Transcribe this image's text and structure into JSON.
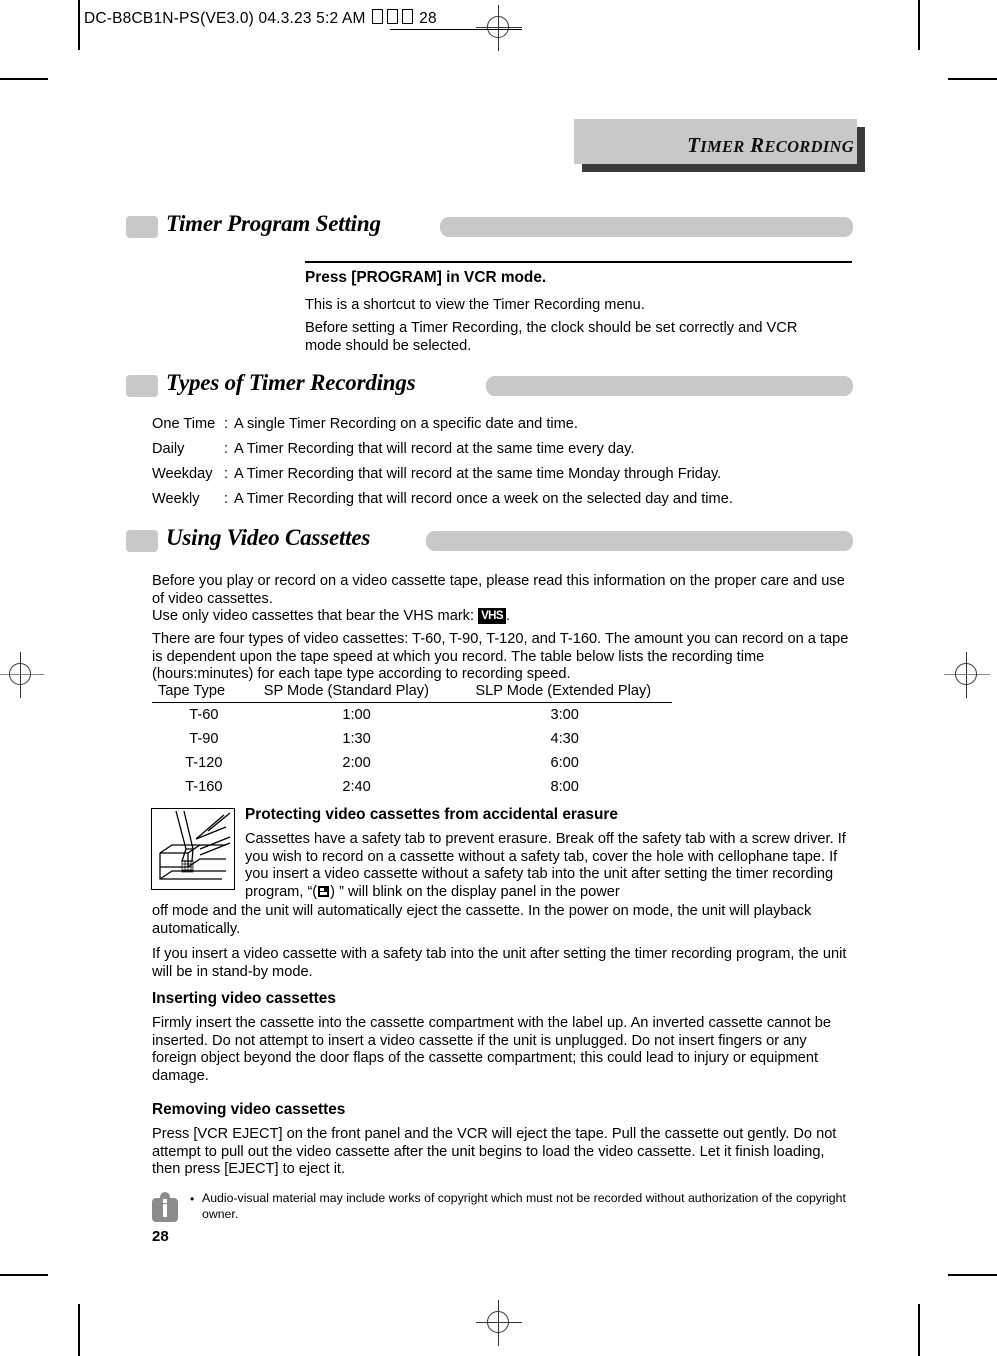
{
  "print_marks": {
    "slug": "DC-B8CB1N-PS(VE3.0)   04.3.23 5:2 AM   ",
    "slug_page": "28"
  },
  "running_head": {
    "word1_cap": "T",
    "word1_rest": "IMER",
    "word2_cap": "R",
    "word2_rest": "ECORDING"
  },
  "sections": {
    "timer_program_setting": {
      "title": "Timer Program Setting",
      "lead": "Press [PROGRAM] in VCR mode.",
      "line1": "This is a shortcut to view the Timer Recording menu.",
      "line2": "Before setting a Timer Recording, the clock should be set correctly and VCR",
      "line3": "mode should be selected."
    },
    "types_of_timer_recordings": {
      "title": "Types of Timer Recordings",
      "rows": [
        {
          "key": "One Time",
          "sep": ":",
          "desc": "A single Timer Recording on a specific date and time."
        },
        {
          "key": "Daily",
          "sep": ":",
          "desc": "A Timer Recording that will record at the same time every day."
        },
        {
          "key": "Weekday",
          "sep": ":",
          "desc": "A Timer Recording that will record at the same time Monday through Friday."
        },
        {
          "key": "Weekly",
          "sep": ":",
          "desc": "A Timer Recording that will record once a week on the selected day and time."
        }
      ]
    },
    "using_video_cassettes": {
      "title": "Using Video Cassettes",
      "para1": "Before you play or record on a video cassette tape, please read this information on the proper care and use of video cassettes.",
      "vhs_line_prefix": "Use only video cassettes that bear the VHS mark: ",
      "vhs_mark_label": "VHS",
      "vhs_line_suffix": ".",
      "para2": "There are four types of  video cassettes: T-60, T-90, T-120, and T-160. The amount you can record on a tape is dependent upon the tape speed at which you record. The table below lists the recording time (hours:minutes) for each tape type according to recording speed.",
      "table": {
        "headers": [
          "Tape Type",
          "SP Mode (Standard Play)",
          "SLP Mode (Extended Play)"
        ],
        "rows": [
          [
            "T-60",
            "1:00",
            "3:00"
          ],
          [
            "T-90",
            "1:30",
            "4:30"
          ],
          [
            "T-120",
            "2:00",
            "6:00"
          ],
          [
            "T-160",
            "2:40",
            "8:00"
          ]
        ]
      },
      "protecting": {
        "heading": "Protecting video cassettes from accidental erasure",
        "text_part1": "Cassettes have a safety tab to prevent erasure. Break off the safety tab with a screw driver. If you wish to record on a cassette without a safety tab, cover the hole with cellophane  tape. If you insert a video cassette without a safety tab into the unit after setting the timer recording program, “(",
        "text_part2": ") ” will blink on the display panel in the power",
        "text_part3": "off mode and the unit will automatically eject the cassette. In the power on mode, the unit will playback automatically."
      },
      "standby_para": "If you insert a video cassette with a safety tab into the unit after setting the timer recording program, the unit will be in stand-by mode.",
      "inserting": {
        "heading": "Inserting video cassettes",
        "text": "Firmly insert the cassette into the cassette compartment with the label up. An inverted cassette cannot be inserted. Do not attempt to insert a video cassette if the unit is unplugged. Do not insert fingers or any foreign object beyond the door flaps of the cassette compartment; this could lead to injury or equipment damage."
      },
      "removing": {
        "heading": "Removing video cassettes",
        "text": "Press [VCR EJECT] on the front panel and the VCR will eject the tape. Pull the cassette out gently. Do not attempt to pull out the video cassette after the unit begins to load the video cassette. Let it finish loading, then press [EJECT] to eject it."
      }
    }
  },
  "footer": {
    "note_bullet": "•",
    "note": "Audio-visual material may include works of copyright which must not be recorded without authorization of the copyright owner.",
    "page_number": "28"
  },
  "colors": {
    "gray_bar": "#c8c8c8",
    "head_shadow": "#3a3a3a",
    "icon_gray": "#8c8c8c"
  }
}
